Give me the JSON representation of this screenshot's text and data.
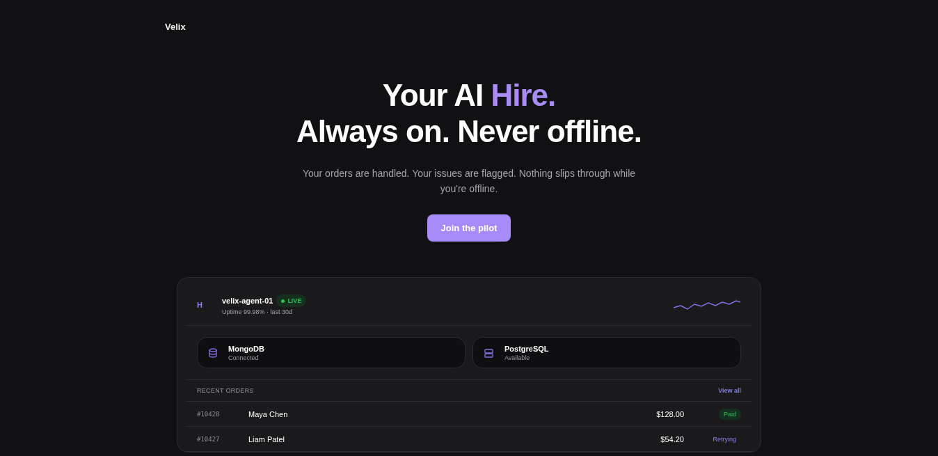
{
  "brand": "Velix",
  "hero": {
    "title_line1": [
      {
        "text": "Your AI ",
        "accent": false
      },
      {
        "text": "Hire.",
        "accent": true
      }
    ],
    "title_line2": "Always on. Never offline.",
    "subtitle": "Your orders are handled. Your issues are flagged. Nothing slips through while you're offline.",
    "cta": "Join the pilot"
  },
  "agent": {
    "avatar": "H",
    "name": "velix-agent-01",
    "status": "LIVE",
    "live": true,
    "uptime": "Uptime 99.98% · last 30d"
  },
  "services": [
    {
      "kind": "database",
      "name": "MongoDB",
      "status": "Connected"
    },
    {
      "kind": "server",
      "name": "PostgreSQL",
      "status": "Available"
    }
  ],
  "orders": {
    "title": "RECENT ORDERS",
    "link": "View all",
    "rows": [
      {
        "id": "#10428",
        "customer": "Maya Chen",
        "amount": "$128.00",
        "status": "Paid",
        "kind": "paid"
      },
      {
        "id": "#10427",
        "customer": "Liam Patel",
        "amount": "$54.20",
        "status": "Retrying",
        "kind": "retrying"
      }
    ]
  }
}
